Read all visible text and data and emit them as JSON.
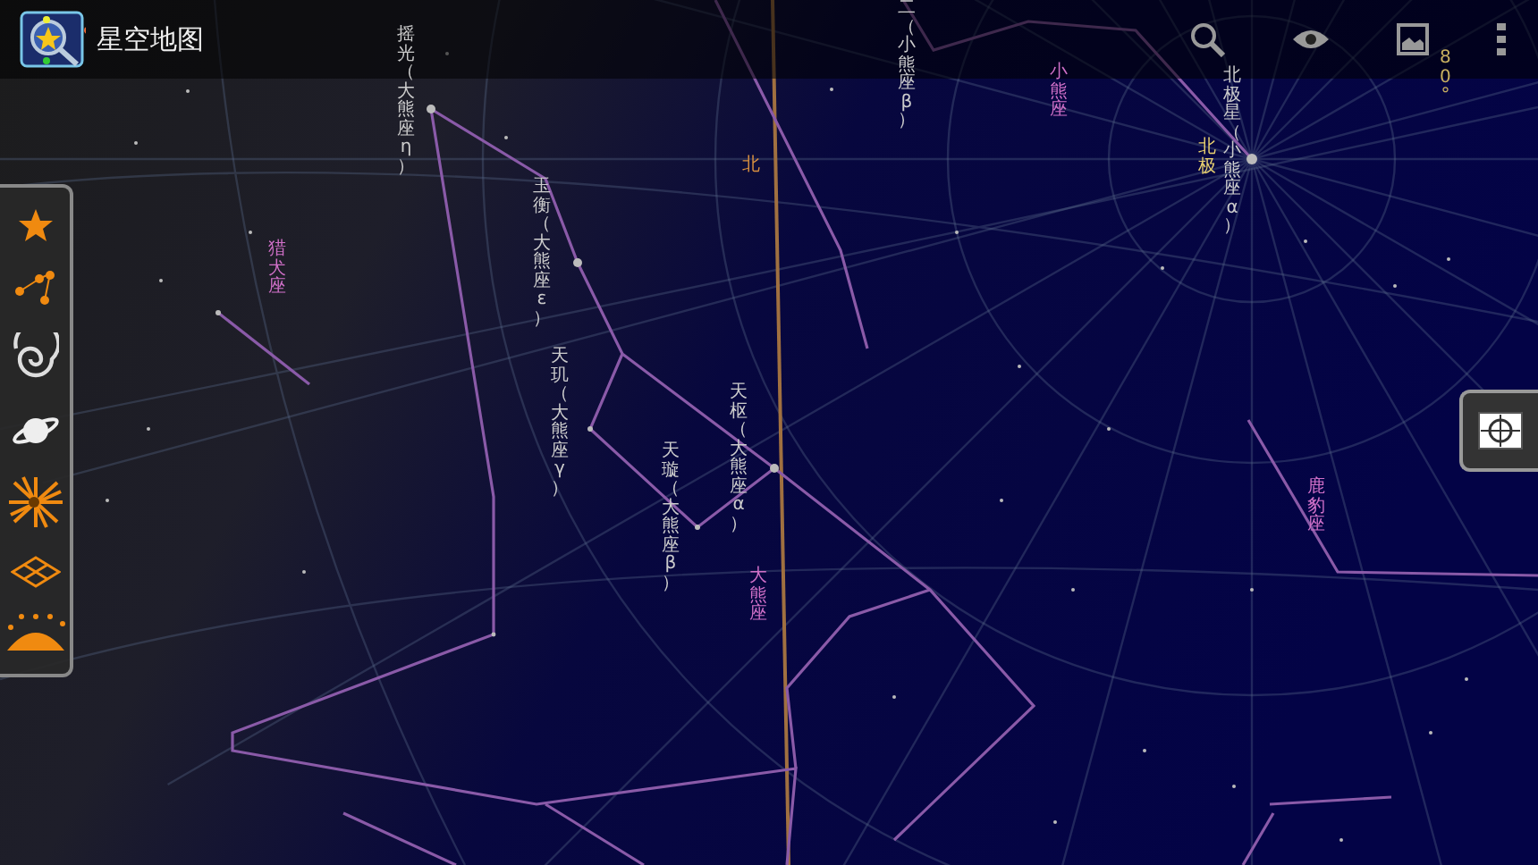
{
  "app_bar": {
    "title": "星空地图"
  },
  "sky_labels": [
    {
      "text": "摇光（大熊座 η）",
      "kind": "star"
    },
    {
      "text": "猎犬座",
      "kind": "constellation"
    },
    {
      "text": "玉衡（大熊座 ε）",
      "kind": "star"
    },
    {
      "text": "天玑（大熊座 γ）",
      "kind": "star"
    },
    {
      "text": "天璇（大熊座 β）",
      "kind": "star"
    },
    {
      "text": "北",
      "kind": "direction"
    },
    {
      "text": "天枢（大熊座 α）",
      "kind": "star"
    },
    {
      "text": "大熊座",
      "kind": "constellation"
    },
    {
      "text": "二（小熊座 β）",
      "kind": "star"
    },
    {
      "text": "小熊座",
      "kind": "constellation"
    },
    {
      "text": "北极",
      "kind": "pole"
    },
    {
      "text": "北极星（小熊座 α）",
      "kind": "star"
    },
    {
      "text": "80°",
      "kind": "grid"
    },
    {
      "text": "鹿豹座",
      "kind": "constellation"
    }
  ]
}
